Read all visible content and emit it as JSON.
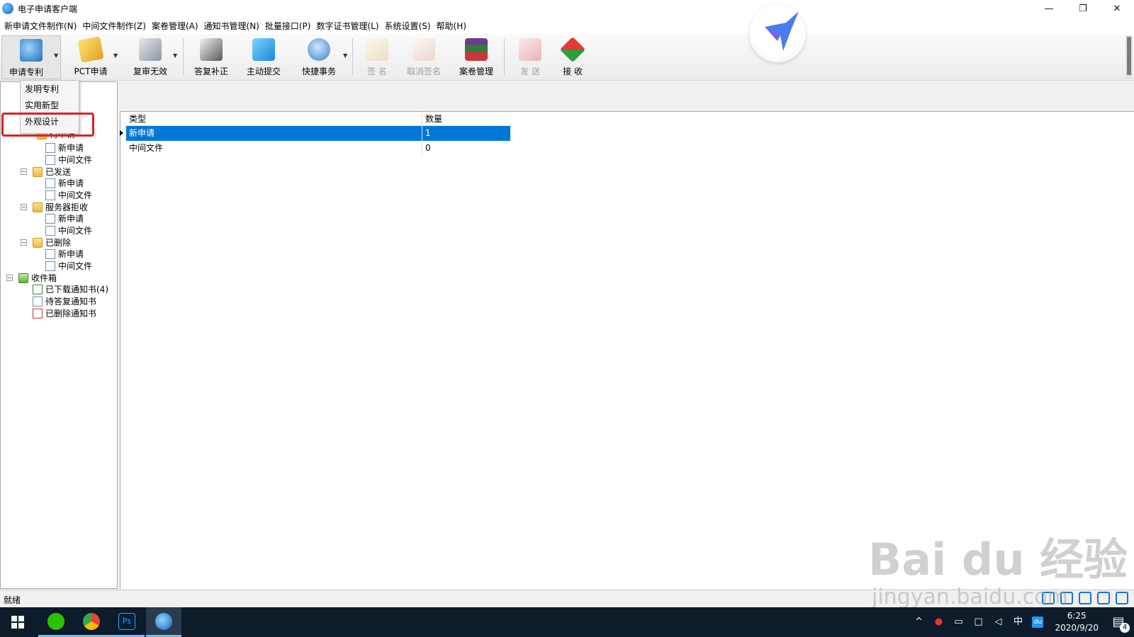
{
  "window": {
    "title": "电子申请客户端",
    "minimize": "—",
    "maximize": "❐",
    "close": "✕"
  },
  "menu": [
    "新申请文件制作(N)",
    "中间文件制作(Z)",
    "案卷管理(A)",
    "通知书管理(N)",
    "批量接口(P)",
    "数字证书管理(L)",
    "系统设置(S)",
    "帮助(H)"
  ],
  "toolbar": {
    "apply_patent": "申请专利",
    "pct": "PCT申请",
    "reexam": "复审无效",
    "reply": "答复补正",
    "submit": "主动提交",
    "quick": "快捷事务",
    "sign": "签 名",
    "unsign": "取消签名",
    "case_mgmt": "案卷管理",
    "send": "发 送",
    "receive": "接 收",
    "colors": {
      "send_icon": "#e03a3a",
      "receive_icon": "#2e9e3a"
    }
  },
  "dropdown": {
    "items": [
      "发明专利",
      "实用新型",
      "外观设计"
    ],
    "highlighted_index": 2
  },
  "tree": {
    "partial_top": "待申请",
    "sent": "已发送",
    "rejected": "服务器拒收",
    "deleted": "已删除",
    "new_app": "新申请",
    "middle_file": "中间文件",
    "inbox": "收件箱",
    "downloaded": "已下载通知书(4)",
    "pending": "待答复通知书",
    "deleted_notices": "已删除通知书"
  },
  "grid": {
    "headers": {
      "type": "类型",
      "count": "数量"
    },
    "rows": [
      {
        "type": "新申请",
        "count": "1",
        "selected": true
      },
      {
        "type": "中间文件",
        "count": "0",
        "selected": false
      }
    ]
  },
  "status": {
    "text": "就绪"
  },
  "watermark": {
    "line1": "Bai du 经验",
    "line2": "jingyan.baidu.com"
  },
  "taskbar": {
    "ime": "中",
    "time": "6:25",
    "date": "2020/9/20",
    "notifications": "4"
  }
}
